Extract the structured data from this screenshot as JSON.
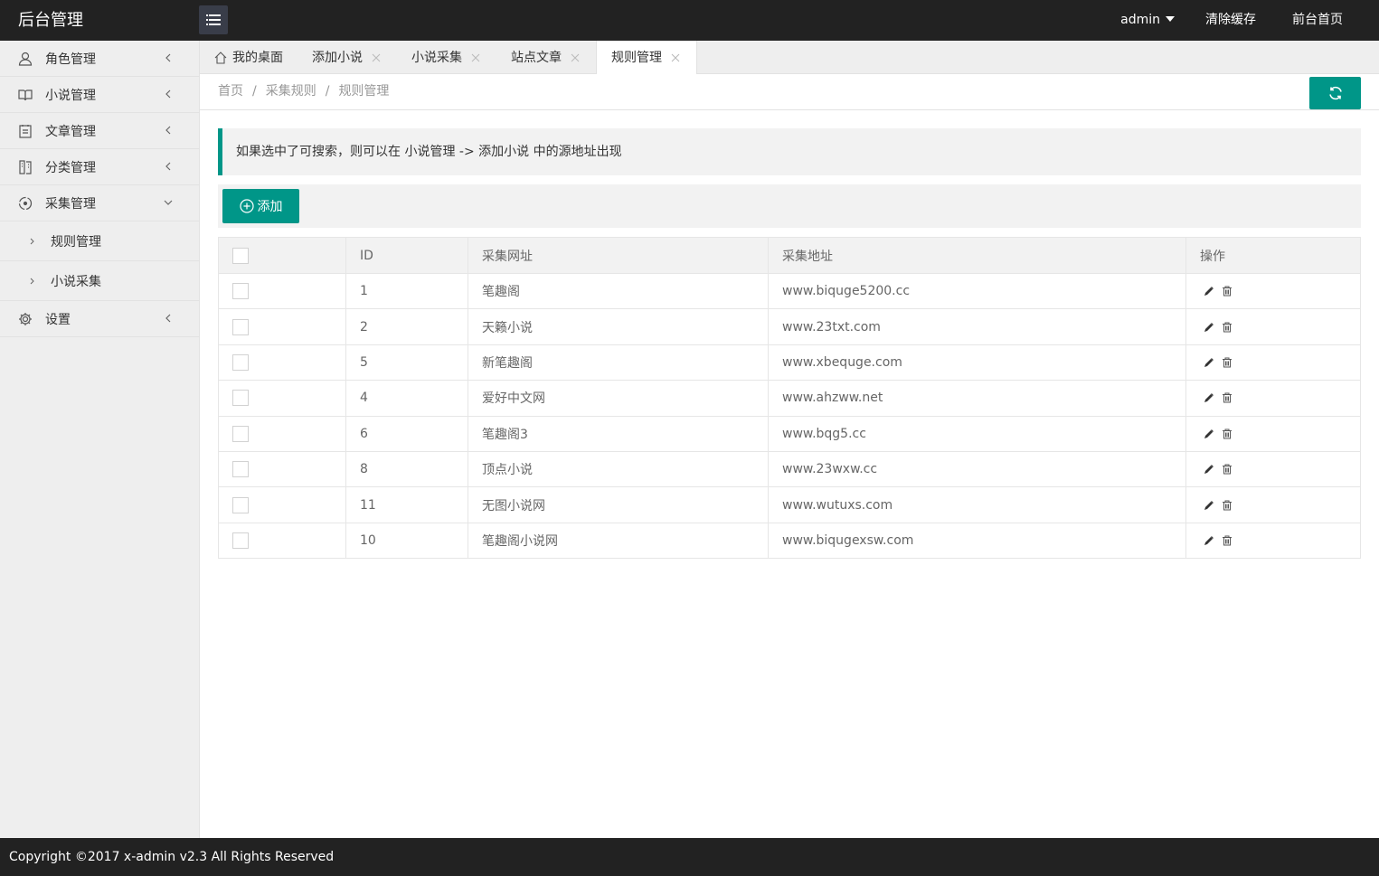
{
  "header": {
    "logo": "后台管理",
    "user": "admin",
    "clear_cache": "清除缓存",
    "front_home": "前台首页"
  },
  "sidebar": {
    "items": [
      {
        "label": "角色管理",
        "icon": "user-icon"
      },
      {
        "label": "小说管理",
        "icon": "book-icon"
      },
      {
        "label": "文章管理",
        "icon": "document-icon"
      },
      {
        "label": "分类管理",
        "icon": "category-icon"
      },
      {
        "label": "采集管理",
        "icon": "collect-icon",
        "expanded": true,
        "children": [
          {
            "label": "规则管理"
          },
          {
            "label": "小说采集"
          }
        ]
      },
      {
        "label": "设置",
        "icon": "gear-icon"
      }
    ]
  },
  "tabs": [
    {
      "label": "我的桌面",
      "home": true
    },
    {
      "label": "添加小说"
    },
    {
      "label": "小说采集"
    },
    {
      "label": "站点文章"
    },
    {
      "label": "规则管理",
      "active": true
    }
  ],
  "breadcrumb": [
    "首页",
    "采集规则",
    "规则管理"
  ],
  "notice": "如果选中了可搜索，则可以在 小说管理 -> 添加小说 中的源地址出现",
  "toolbar": {
    "add_label": "添加"
  },
  "table": {
    "headers": [
      "ID",
      "采集网址",
      "采集地址",
      "操作"
    ],
    "rows": [
      {
        "id": "1",
        "site": "笔趣阁",
        "url": "www.biquge5200.cc"
      },
      {
        "id": "2",
        "site": "天籁小说",
        "url": "www.23txt.com"
      },
      {
        "id": "5",
        "site": "新笔趣阁",
        "url": "www.xbequge.com"
      },
      {
        "id": "4",
        "site": "爱好中文网",
        "url": "www.ahzww.net"
      },
      {
        "id": "6",
        "site": "笔趣阁3",
        "url": "www.bqg5.cc"
      },
      {
        "id": "8",
        "site": "顶点小说",
        "url": "www.23wxw.cc"
      },
      {
        "id": "11",
        "site": "无图小说网",
        "url": "www.wutuxs.com"
      },
      {
        "id": "10",
        "site": "笔趣阁小说网",
        "url": "www.biqugexsw.com"
      }
    ]
  },
  "footer": "Copyright ©2017 x-admin v2.3 All Rights Reserved",
  "colors": {
    "accent": "#009688",
    "header_bg": "#222222",
    "sidebar_bg": "#EEEEEE"
  }
}
